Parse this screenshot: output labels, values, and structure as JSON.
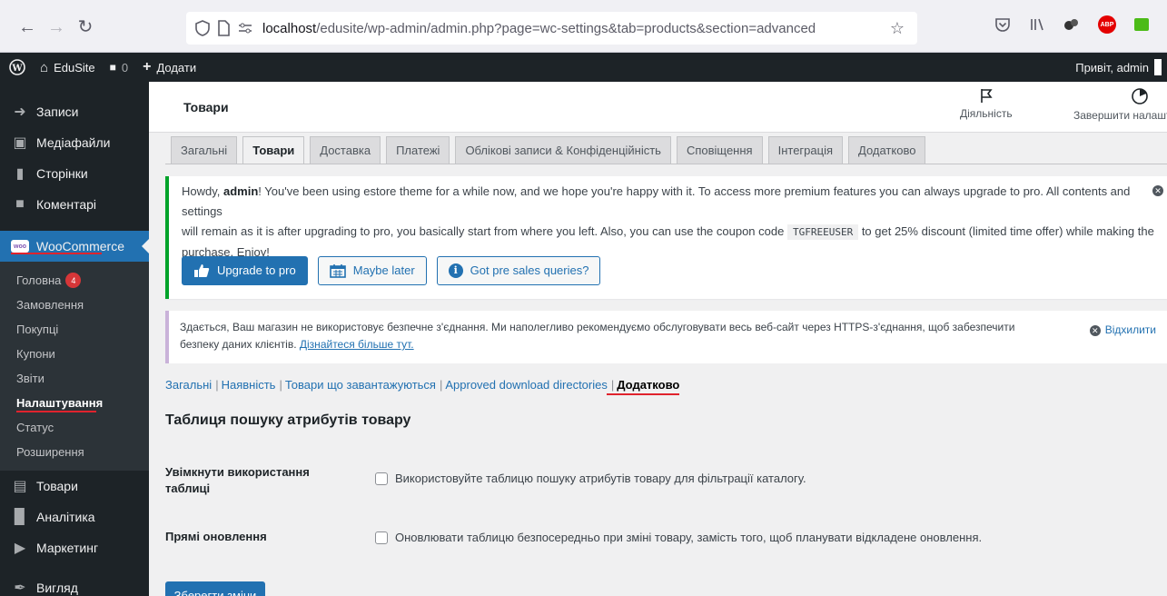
{
  "browser": {
    "url_host": "localhost",
    "url_path": "/edusite/wp-admin/admin.php?page=wc-settings&tab=products&section=advanced"
  },
  "adminbar": {
    "site_name": "EduSite",
    "comments_count": "0",
    "add_new": "Додати",
    "greeting": "Привіт, admin"
  },
  "sidebar": {
    "items_top": [
      "Записи",
      "Медіафайли",
      "Сторінки",
      "Коментарі"
    ],
    "woocommerce": "WooCommerce",
    "woo_logo": "woo",
    "submenu": {
      "home": "Головна",
      "home_badge": "4",
      "orders": "Замовлення",
      "customers": "Покупці",
      "coupons": "Купони",
      "reports": "Звіти",
      "settings": "Налаштування",
      "status": "Статус",
      "extensions": "Розширення"
    },
    "items_bottom": [
      "Товари",
      "Аналітика",
      "Маркетинг",
      "Вигляд"
    ]
  },
  "header": {
    "title": "Товари",
    "activity": "Діяльність",
    "finish_setup": "Завершити налаштування"
  },
  "tabs": [
    "Загальні",
    "Товари",
    "Доставка",
    "Платежі",
    "Облікові записи & Конфіденційність",
    "Сповіщення",
    "Інтеграція",
    "Додатково"
  ],
  "notice": {
    "line1_a": "Howdy, ",
    "line1_admin": "admin",
    "line1_b": "! You've been using estore theme for a while now, and we hope you're happy with it. To access more premium features you can always upgrade to pro. All contents and settings",
    "line2_a": "will remain as it is after upgrading to pro, you basically start from where you left. Also, you can use the coupon code ",
    "coupon": "TGFREEUSER",
    "line2_b": " to get 25% discount (limited time offer) while making the",
    "line3": "purchase. Enjoy!",
    "btn_upgrade": "Upgrade to pro",
    "btn_later": "Maybe later",
    "btn_queries": "Got pre sales queries?"
  },
  "https_notice": {
    "text1": "Здається, Ваш магазин не використовує безпечне з'єднання. Ми наполегливо рекомендуємо обслуговувати весь веб-сайт через HTTPS-з'єднання, щоб забезпечити",
    "text2": "безпеку даних клієнтів. ",
    "link": "Дізнайтеся більше тут.",
    "dismiss": "Відхилити"
  },
  "sections": {
    "general": "Загальні",
    "inventory": "Наявність",
    "downloadable": "Товари що завантажуються",
    "approved": "Approved download directories",
    "advanced": "Додатково"
  },
  "page": {
    "section_title": "Таблиця пошуку атрибутів товару",
    "row1_label": "Увімкнути використання таблиці",
    "row1_desc": "Використовуйте таблицю пошуку атрибутів товару для фільтрації каталогу.",
    "row2_label": "Прямі оновлення",
    "row2_desc": "Оновлювати таблицю безпосередньо при зміні товару, замість того, щоб планувати відкладене оновлення.",
    "save": "Зберегти зміни"
  }
}
